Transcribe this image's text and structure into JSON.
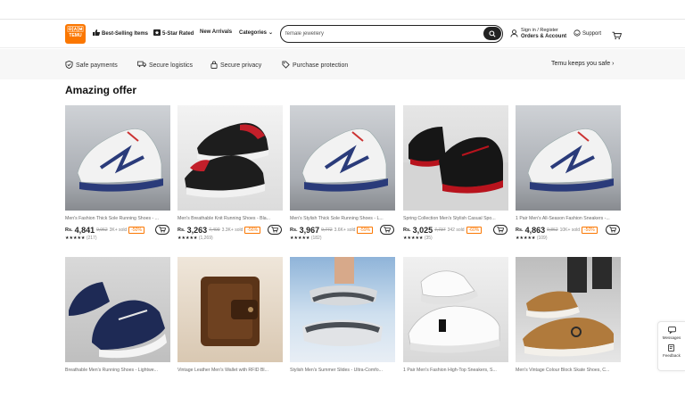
{
  "header": {
    "logo": {
      "top": "🄾🄰🄼",
      "bottom": "TEMU"
    },
    "nav": [
      {
        "label": "Best-Selling Items"
      },
      {
        "label": "5-Star Rated"
      },
      {
        "label": "New Arrivals"
      },
      {
        "label": "Categories"
      }
    ],
    "search": {
      "value": "female jewellery"
    },
    "account": {
      "line1": "Sign in / Register",
      "line2": "Orders & Account"
    },
    "support": "Support"
  },
  "trust": {
    "items": [
      "Safe payments",
      "Secure logistics",
      "Secure privacy",
      "Purchase protection"
    ],
    "right": "Temu keeps you safe"
  },
  "section_title": "Amazing offer",
  "products": [
    {
      "name": "Men's Fashion Thick Sole Running Shoes - ...",
      "currency": "Rs.",
      "price": "4,841",
      "old": "9,962",
      "sold": "3K+ sold",
      "discount": "-50%",
      "stars": "★★★★★",
      "count": "(217)"
    },
    {
      "name": "Men's Breathable Knit Running Shoes - Bla...",
      "currency": "Rs.",
      "price": "3,263",
      "old": "7,409",
      "sold": "3.3K+ sold",
      "discount": "-56%",
      "stars": "★★★★★",
      "count": "(1,269)"
    },
    {
      "name": "Men's Stylish Thick Sole Running Shoes - L...",
      "currency": "Rs.",
      "price": "3,967",
      "old": "9,772",
      "sold": "3.6K+ sold",
      "discount": "-59%",
      "stars": "★★★★★",
      "count": "(182)"
    },
    {
      "name": "Spring Collection Men's Stylish Casual Spo...",
      "currency": "Rs.",
      "price": "3,025",
      "old": "7,737",
      "sold": "342 sold",
      "discount": "-60%",
      "stars": "★★★★★",
      "count": "(35)"
    },
    {
      "name": "1 Pair Men's All-Season Fashion Sneakers -...",
      "currency": "Rs.",
      "price": "4,863",
      "old": "9,862",
      "sold": "10K+ sold",
      "discount": "-50%",
      "stars": "★★★★★",
      "count": "(109)"
    },
    {
      "name": "Breathable Men's Running Shoes - Lightwe..."
    },
    {
      "name": "Vintage Leather Men's Wallet with RFID Bl..."
    },
    {
      "name": "Stylish Men's Summer Slides - Ultra-Comfo..."
    },
    {
      "name": "1 Pair Men's Fashion High-Top Sneakers, S..."
    },
    {
      "name": "Men's Vintage Colour Block Skate Shoes, C..."
    }
  ],
  "side": {
    "messages": "Messages",
    "feedback": "Feedback"
  },
  "colors": {
    "brand": "#fb7701"
  }
}
